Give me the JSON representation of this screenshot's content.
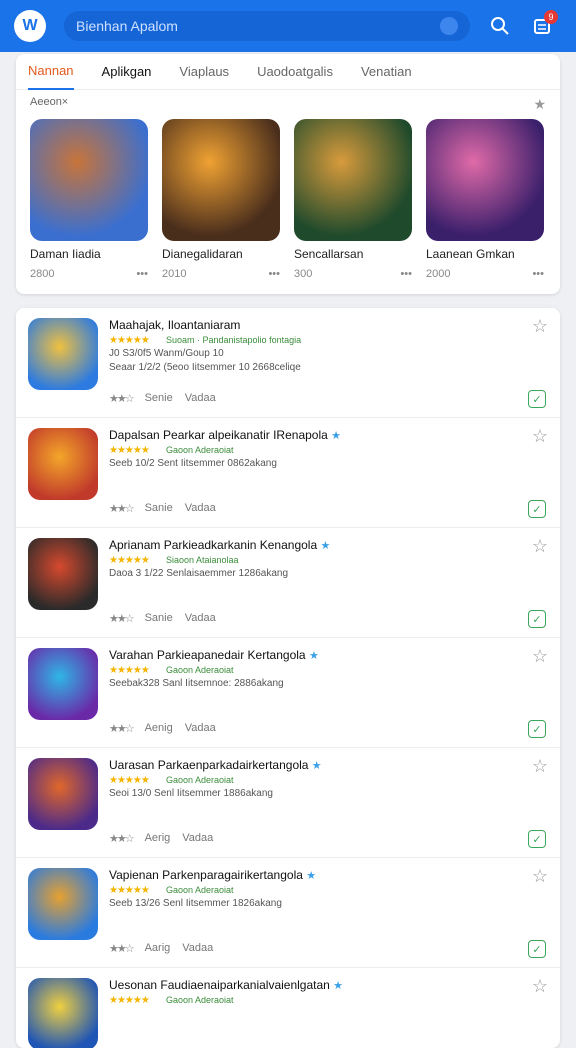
{
  "header": {
    "logo_text": "W",
    "search_placeholder": "Bienhan Apalom",
    "notification_count": "9"
  },
  "tabs": [
    {
      "label": "Nannan"
    },
    {
      "label": "Aplikgan"
    },
    {
      "label": "Viaplaus"
    },
    {
      "label": "Uaodoatgalis"
    },
    {
      "label": "Venatian"
    }
  ],
  "featured": {
    "section_label": "Aeeon×",
    "items": [
      {
        "title": "Daman Iiadia",
        "meta": "2800",
        "color_a": "#3b6fcf",
        "color_b": "#c8743a"
      },
      {
        "title": "Dianegalidaran",
        "meta": "2010",
        "color_a": "#4a2e1c",
        "color_b": "#f0a233"
      },
      {
        "title": "Sencallarsan",
        "meta": "300",
        "color_a": "#1f4a2c",
        "color_b": "#d89b3c"
      },
      {
        "title": "Laanean Gmkan",
        "meta": "2000",
        "color_a": "#3a1f6b",
        "color_b": "#e06aa8"
      }
    ]
  },
  "apps": [
    {
      "title": "Maahajak, Iloantaniaram",
      "l1": "Suoam · Pandanistapolio fontagia",
      "l3": "J0 S3/0f5  Wanm/Goup  10",
      "l4": "Seaar 1/2/2  (5eoo Iitsemmer 10  2668celiqe",
      "b1": "Senie",
      "b2": "Vadaa",
      "c1": "#2d7be0",
      "c2": "#f0c040"
    },
    {
      "title": "Dapalsan Pearkar alpeikanatir IRenapola",
      "l1": "Gaoon  Aderaoiat",
      "l3": "Seeb 10/2  Sent Iitsemmer  0862akang",
      "l4": "",
      "b1": "Sanie",
      "b2": "Vadaa",
      "c1": "#c0392b",
      "c2": "#f4a62a"
    },
    {
      "title": "Aprianam Parkieadkarkanin Kenangola",
      "l1": "Siaoon  Ataianolaa",
      "l3": "Daoa 3 1/22  Senlaisaemmer  1286akang",
      "l4": "",
      "b1": "Sanie",
      "b2": "Vadaa",
      "c1": "#2a2a2a",
      "c2": "#d6492e"
    },
    {
      "title": "Varahan Parkieapanedair Kertangola",
      "l1": "Gaoon  Aderaoiat",
      "l3": "Seebak328  Sanl Iitsemnoe:  2886akang",
      "l4": "",
      "b1": "Aenig",
      "b2": "Vadaa",
      "c1": "#6a2aa8",
      "c2": "#2fb6e6"
    },
    {
      "title": "Uarasan Parkaenparkadairkertangola",
      "l1": "Gaoon  Aderaoiat",
      "l3": "Seoi 13/0  Senl Iitsemmer  1886akang",
      "l4": "",
      "b1": "Aerig",
      "b2": "Vadaa",
      "c1": "#4b2a8a",
      "c2": "#e0672a"
    },
    {
      "title": "Vapienan Parkenparagairikertangola",
      "l1": "Gaoon  Aderaoiat",
      "l3": "Seeb 13/26  Senl Iitsemmer  1826akang",
      "l4": "",
      "b1": "Aarig",
      "b2": "Vadaa",
      "c1": "#2a7be0",
      "c2": "#e6a030"
    },
    {
      "title": "Uesonan Faudiaenaiparkanialvaienlgatan",
      "l1": "Gaoon  Aderaoiat",
      "l3": "",
      "l4": "",
      "b1": "",
      "b2": "",
      "c1": "#1f55b5",
      "c2": "#f0d040"
    }
  ]
}
